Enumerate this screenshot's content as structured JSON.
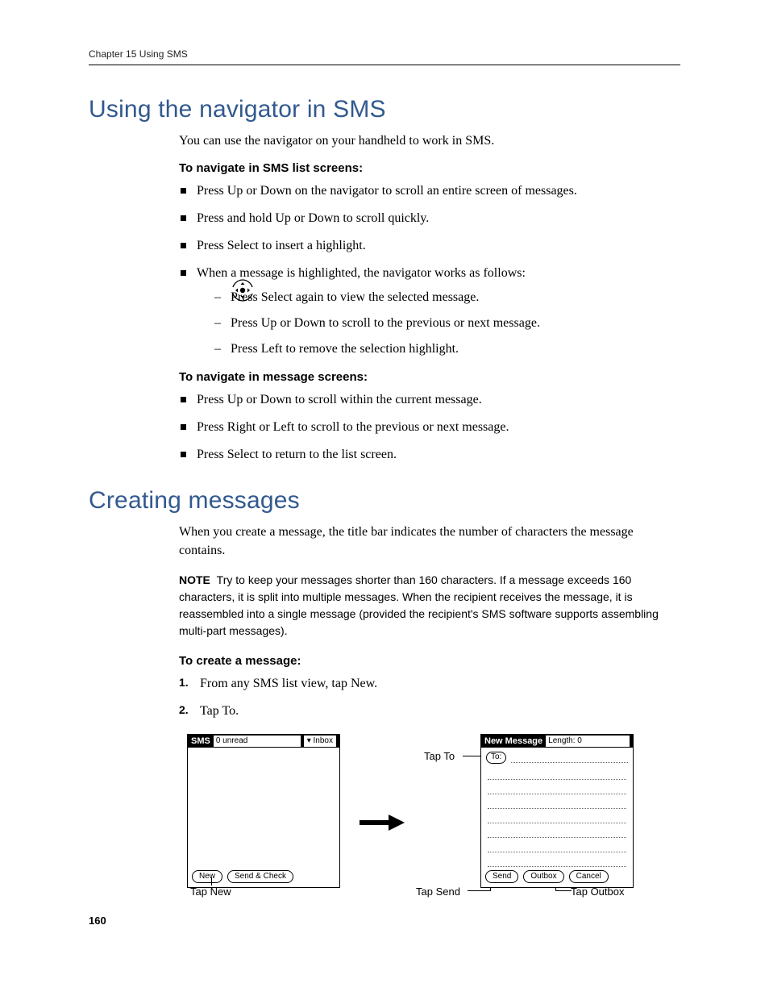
{
  "running_head": "Chapter 15   Using SMS",
  "page_number": "160",
  "section1": {
    "title": "Using the navigator in SMS",
    "intro": "You can use the navigator on your handheld to work in SMS.",
    "sub1_title": "To navigate in SMS list screens:",
    "sub1_bullets": [
      "Press Up or Down on the navigator to scroll an entire screen of messages.",
      "Press and hold Up or Down to scroll quickly.",
      "Press Select to insert a highlight.",
      "When a message is highlighted, the navigator works as follows:"
    ],
    "sub1_nested": [
      "Press Select again to view the selected message.",
      "Press Up or Down to scroll to the previous or next message.",
      "Press Left to remove the selection highlight."
    ],
    "sub2_title": "To navigate in message screens:",
    "sub2_bullets": [
      "Press Up or Down to scroll within the current message.",
      "Press Right or Left to scroll to the previous or next message.",
      "Press Select to return to the list screen."
    ]
  },
  "section2": {
    "title": "Creating messages",
    "intro": "When you create a message, the title bar indicates the number of characters the message contains.",
    "note_label": "NOTE",
    "note_body": "Try to keep your messages shorter than 160 characters. If a message exceeds 160 characters, it is split into multiple messages. When the recipient receives the message, it is reassembled into a single message (provided the recipient's SMS software supports assembling multi-part messages).",
    "sub_title": "To create a message:",
    "steps": [
      "From any SMS list view, tap New.",
      "Tap To."
    ]
  },
  "figure": {
    "left": {
      "title_app": "SMS",
      "title_status": "0 unread",
      "title_folder": "Inbox",
      "btn_new": "New",
      "btn_sendcheck": "Send & Check",
      "caption": "Tap New"
    },
    "right": {
      "title_app": "New Message",
      "title_length": "Length: 0",
      "to_label": "To:",
      "btn_send": "Send",
      "btn_outbox": "Outbox",
      "btn_cancel": "Cancel"
    },
    "callouts": {
      "tap_to": "Tap To",
      "tap_send": "Tap Send",
      "tap_outbox": "Tap Outbox"
    }
  }
}
